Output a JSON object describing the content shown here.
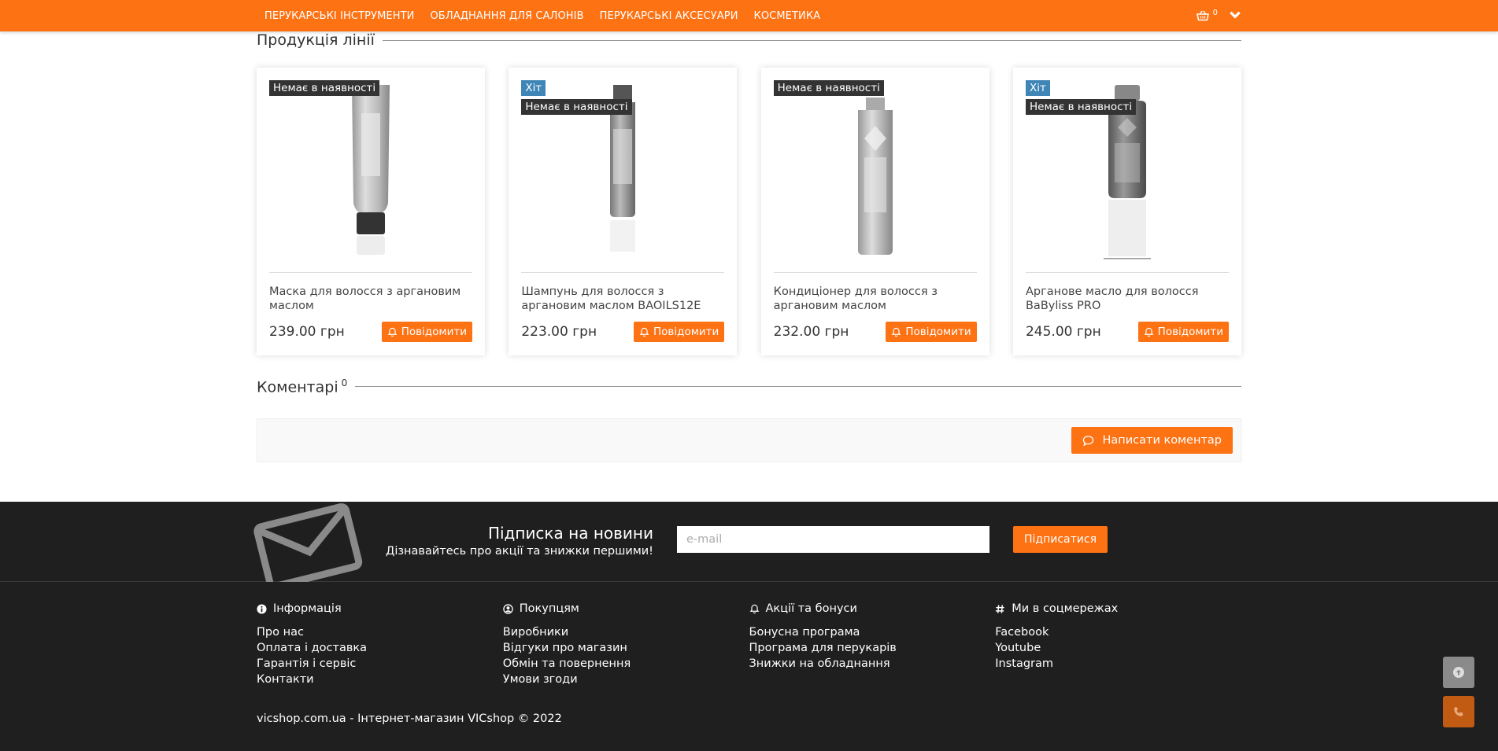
{
  "nav": {
    "items": [
      "ПЕРУКАРСЬКІ ІНСТРУМЕНТИ",
      "ОБЛАДНАННЯ ДЛЯ САЛОНІВ",
      "ПЕРУКАРСЬКІ АКСЕСУАРИ",
      "КОСМЕТИКА"
    ],
    "cart_count": "0"
  },
  "products_section": {
    "title": "Продукція лінії"
  },
  "products": [
    {
      "badges": [
        "Немає в наявності"
      ],
      "name": "Маска для волосся з аргановим маслом",
      "price": "239.00 грн",
      "notify_label": "Повідомити"
    },
    {
      "badges": [
        "Хіт",
        "Немає в наявності"
      ],
      "name": "Шампунь для волосся з аргановим маслом BAOILS12E",
      "price": "223.00 грн",
      "notify_label": "Повідомити"
    },
    {
      "badges": [
        "Немає в наявності"
      ],
      "name": "Кондиціонер для волосся з аргановим маслом",
      "price": "232.00 грн",
      "notify_label": "Повідомити"
    },
    {
      "badges": [
        "Хіт",
        "Немає в наявності"
      ],
      "name": "Арганове масло для волосся BaByliss PRO",
      "price": "245.00 грн",
      "notify_label": "Повідомити"
    }
  ],
  "comments": {
    "title": "Коментарі",
    "count": "0",
    "write_label": "Написати коментар"
  },
  "subscribe": {
    "title": "Підписка на новини",
    "description": "Дізнавайтесь про акції та знижки першими!",
    "placeholder": "e-mail",
    "button_label": "Підписатися"
  },
  "footer": {
    "columns": [
      {
        "title": "Інформація",
        "icon": "info-icon",
        "links": [
          "Про нас",
          "Оплата і доставка",
          "Гарантія і сервіс",
          "Контакти"
        ]
      },
      {
        "title": "Покупцям",
        "icon": "user-circle-icon",
        "links": [
          "Виробники",
          "Відгуки про магазин",
          "Обмін та повернення",
          "Умови згоди"
        ]
      },
      {
        "title": "Акції та бонуси",
        "icon": "bell-icon",
        "links": [
          "Бонусна програма",
          "Програма для перукарів",
          "Знижки на обладнання"
        ]
      },
      {
        "title": "Ми в соцмережах",
        "icon": "hashtag-icon",
        "links": [
          "Facebook",
          "Youtube",
          "Instagram"
        ]
      }
    ],
    "copyright": "vicshop.com.ua - Інтернет-магазин VICshop © 2022"
  },
  "colors": {
    "accent": "#fd7213",
    "hit_badge": "#3f86b7",
    "out_badge": "#333333",
    "footer_bg": "#1f1f1f"
  }
}
